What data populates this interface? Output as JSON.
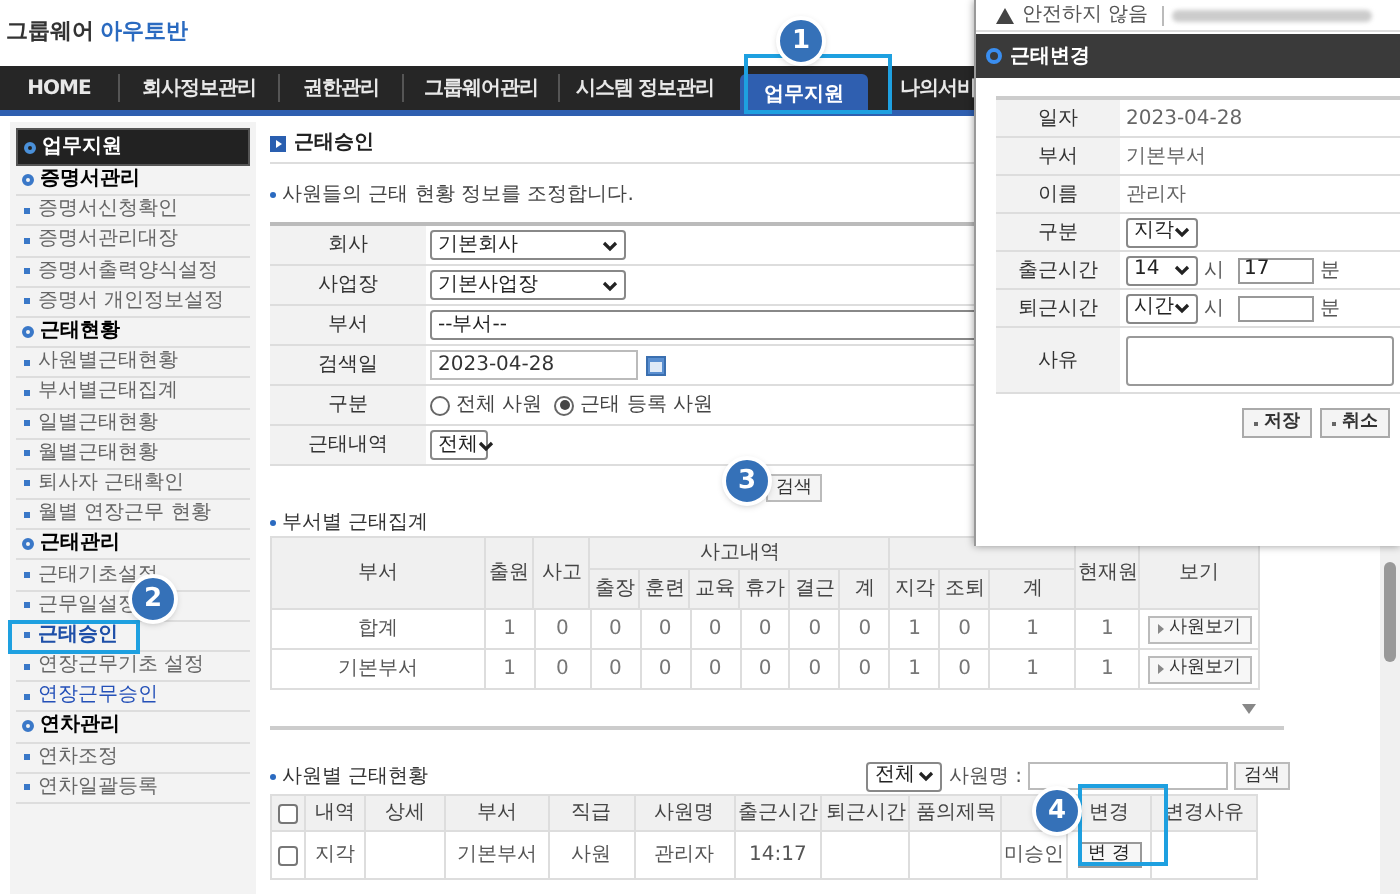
{
  "header": {
    "logo_prefix": "그룹웨어",
    "logo_name": "아우토반"
  },
  "nav": [
    {
      "label": "HOME",
      "selected": false
    },
    {
      "label": "회사정보관리",
      "selected": false
    },
    {
      "label": "권한관리",
      "selected": false
    },
    {
      "label": "그룹웨어관리",
      "selected": false
    },
    {
      "label": "시스템 정보관리",
      "selected": false
    },
    {
      "label": "업무지원",
      "selected": true
    },
    {
      "label": "나의서비",
      "selected": false
    }
  ],
  "sidebar": {
    "title": "업무지원",
    "groups": [
      {
        "label": "증명서관리",
        "items": [
          {
            "label": "증명서신청확인",
            "selected": false,
            "highlighted": false
          },
          {
            "label": "증명서관리대장",
            "selected": false,
            "highlighted": false
          },
          {
            "label": "증명서출력양식설정",
            "selected": false,
            "highlighted": false
          },
          {
            "label": "증명서 개인정보설정",
            "selected": false,
            "highlighted": false
          }
        ]
      },
      {
        "label": "근태현황",
        "items": [
          {
            "label": "사원별근태현황",
            "selected": false,
            "highlighted": false
          },
          {
            "label": "부서별근태집계",
            "selected": false,
            "highlighted": false
          },
          {
            "label": "일별근태현황",
            "selected": false,
            "highlighted": false
          },
          {
            "label": "월별근태현황",
            "selected": false,
            "highlighted": false
          },
          {
            "label": "퇴사자 근태확인",
            "selected": false,
            "highlighted": false
          },
          {
            "label": "월별 연장근무 현황",
            "selected": false,
            "highlighted": false
          }
        ]
      },
      {
        "label": "근태관리",
        "items": [
          {
            "label": "근태기초설정",
            "selected": false,
            "highlighted": false
          },
          {
            "label": "근무일설정",
            "selected": false,
            "highlighted": false
          },
          {
            "label": "근태승인",
            "selected": true,
            "highlighted": false
          },
          {
            "label": "연장근무기초 설정",
            "selected": false,
            "highlighted": false
          },
          {
            "label": "연장근무승인",
            "selected": false,
            "highlighted": true
          }
        ]
      },
      {
        "label": "연차관리",
        "items": [
          {
            "label": "연차조정",
            "selected": false,
            "highlighted": false
          },
          {
            "label": "연차일괄등록",
            "selected": false,
            "highlighted": false
          }
        ]
      }
    ]
  },
  "main": {
    "title": "근태승인",
    "description": "사원들의 근태 현황 정보를 조정합니다.",
    "search_form": {
      "rows": [
        {
          "kind": "select",
          "label": "회사",
          "value": "기본회사"
        },
        {
          "kind": "select",
          "label": "사업장",
          "value": "기본사업장"
        },
        {
          "kind": "wide_select",
          "label": "부서",
          "value": "--부서--"
        },
        {
          "kind": "date",
          "label": "검색일",
          "value": "2023-04-28"
        },
        {
          "kind": "radio",
          "label": "구분",
          "options": [
            {
              "label": "전체 사원",
              "selected": false
            },
            {
              "label": "근태 등록 사원",
              "selected": true
            }
          ]
        },
        {
          "kind": "small_select",
          "label": "근태내역",
          "value": "전체"
        }
      ],
      "search_button": "검색"
    },
    "dept_summary": {
      "title": "부서별 근태집계",
      "header": {
        "dept": "부서",
        "count": "출원",
        "incident": "사고",
        "incident_group": "사고내역",
        "incident_cols": [
          "출장",
          "훈련",
          "교육",
          "휴가",
          "결근",
          "계"
        ],
        "late_cols": [
          "지각",
          "조퇴",
          "계"
        ],
        "present": "현재원",
        "view": "보기"
      },
      "rows": [
        {
          "dept": "합계",
          "values": [
            "1",
            "0",
            "0",
            "0",
            "0",
            "0",
            "0",
            "0",
            "1",
            "0",
            "1",
            "1"
          ],
          "button": "사원보기"
        },
        {
          "dept": "기본부서",
          "values": [
            "1",
            "0",
            "0",
            "0",
            "0",
            "0",
            "0",
            "0",
            "1",
            "0",
            "1",
            "1"
          ],
          "button": "사원보기"
        }
      ]
    },
    "employee_status": {
      "title": "사원별 근태현황",
      "filter": "전체",
      "name_label": "사원명 :",
      "search_button": "검색",
      "all_checked": false,
      "columns": [
        "내역",
        "상세",
        "부서",
        "직급",
        "사원명",
        "출근시간",
        "퇴근시간",
        "품의제목",
        "변경",
        "변경사유"
      ],
      "rows": [
        {
          "checked": false,
          "type": "지각",
          "dept": "기본부서",
          "rank": "사원",
          "name": "관리자",
          "in_time": "14:17",
          "status": "미승인",
          "change_button": "변 경"
        }
      ]
    }
  },
  "popup": {
    "security": "안전하지 않음",
    "title": "근태변경",
    "fields": [
      {
        "kind": "text",
        "label": "일자",
        "value": "2023-04-28"
      },
      {
        "kind": "text",
        "label": "부서",
        "value": "기본부서"
      },
      {
        "kind": "text",
        "label": "이름",
        "value": "관리자"
      },
      {
        "kind": "select",
        "label": "구분",
        "value": "지각"
      },
      {
        "kind": "time",
        "label": "출근시간",
        "hour": "14",
        "hour_unit": "시",
        "minute": "17",
        "minute_unit": "분"
      },
      {
        "kind": "time",
        "label": "퇴근시간",
        "hour": "시간",
        "hour_unit": "시",
        "minute_unit": "분"
      },
      {
        "kind": "textarea",
        "label": "사유"
      }
    ],
    "buttons": [
      "저장",
      "취소"
    ]
  },
  "step_markers": [
    "1",
    "2",
    "3",
    "4"
  ]
}
